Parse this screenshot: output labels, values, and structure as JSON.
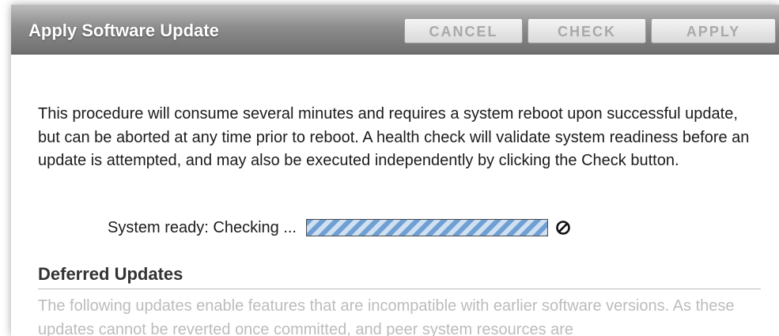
{
  "dialog": {
    "title": "Apply Software Update",
    "buttons": {
      "cancel_label": "CANCEL",
      "check_label": "CHECK",
      "apply_label": "APPLY"
    },
    "description": "This procedure will consume several minutes and requires a system reboot upon successful update, but can be aborted at any time prior to reboot. A health check will validate system readiness before an update is attempted, and may also be executed independently by clicking the Check button.",
    "status": {
      "label": "System ready: Checking ...",
      "progress_state": "indeterminate",
      "cancel_icon": "cancel-circle-icon"
    }
  },
  "deferred": {
    "title": "Deferred Updates",
    "text": "The following updates enable features that are incompatible with earlier software versions. As these updates cannot be reverted once committed, and peer system resources are"
  },
  "colors": {
    "titlebar": "#7c7c7c",
    "progress_stripe_dark": "#6f9fd3",
    "progress_stripe_light": "#cfe0f1",
    "muted_text": "#bcbcbc"
  }
}
